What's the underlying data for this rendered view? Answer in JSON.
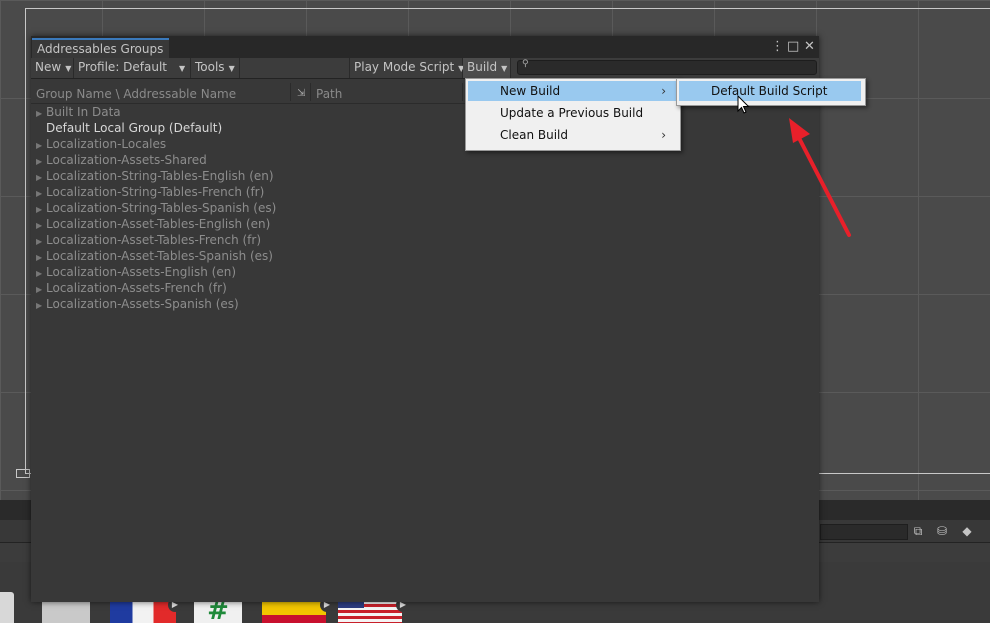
{
  "window": {
    "title": "Addressables Groups",
    "controls": {
      "more": "⋮",
      "maximize": "□",
      "close": "✕"
    }
  },
  "toolbar": {
    "new": "New",
    "profile": "Profile: Default",
    "tools": "Tools",
    "play_mode": "Play Mode Script",
    "build": "Build",
    "search_icon": "search-icon"
  },
  "columns": {
    "name": "Group Name \\ Addressable Name",
    "path": "Path"
  },
  "groups": [
    {
      "label": "Built In Data",
      "expandable": true,
      "highlight": false
    },
    {
      "label": "Default Local Group (Default)",
      "expandable": false,
      "highlight": true
    },
    {
      "label": "Localization-Locales",
      "expandable": true,
      "highlight": false
    },
    {
      "label": "Localization-Assets-Shared",
      "expandable": true,
      "highlight": false
    },
    {
      "label": "Localization-String-Tables-English (en)",
      "expandable": true,
      "highlight": false
    },
    {
      "label": "Localization-String-Tables-French (fr)",
      "expandable": true,
      "highlight": false
    },
    {
      "label": "Localization-String-Tables-Spanish (es)",
      "expandable": true,
      "highlight": false
    },
    {
      "label": "Localization-Asset-Tables-English (en)",
      "expandable": true,
      "highlight": false
    },
    {
      "label": "Localization-Asset-Tables-French (fr)",
      "expandable": true,
      "highlight": false
    },
    {
      "label": "Localization-Asset-Tables-Spanish (es)",
      "expandable": true,
      "highlight": false
    },
    {
      "label": "Localization-Assets-English (en)",
      "expandable": true,
      "highlight": false
    },
    {
      "label": "Localization-Assets-French (fr)",
      "expandable": true,
      "highlight": false
    },
    {
      "label": "Localization-Assets-Spanish (es)",
      "expandable": true,
      "highlight": false
    }
  ],
  "build_menu": {
    "items": [
      {
        "label": "New Build",
        "submenu": true,
        "selected": true
      },
      {
        "label": "Update a Previous Build",
        "submenu": false,
        "selected": false
      },
      {
        "label": "Clean Build",
        "submenu": true,
        "selected": false
      }
    ]
  },
  "submenu": {
    "items": [
      {
        "label": "Default Build Script",
        "selected": true
      }
    ]
  },
  "colors": {
    "menu_selected": "#99c9ef",
    "tab_accent": "#3a79bb",
    "arrow": "#e8202a"
  }
}
